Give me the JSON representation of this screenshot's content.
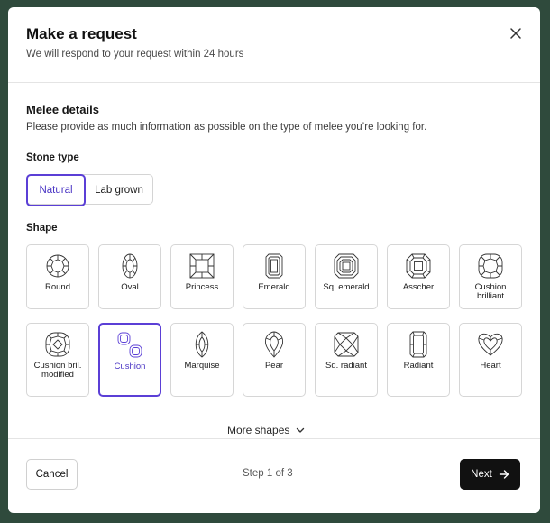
{
  "header": {
    "title": "Make a request",
    "subtitle": "We will respond to your request within 24 hours",
    "close_icon": "close-icon"
  },
  "section": {
    "title": "Melee details",
    "description": "Please provide as much information as possible on the type of melee you’re looking for."
  },
  "stone_type": {
    "label": "Stone type",
    "options": [
      "Natural",
      "Lab grown"
    ],
    "selected": "Natural"
  },
  "shape": {
    "label": "Shape",
    "options": [
      {
        "name": "Round",
        "icon": "round-diamond-icon"
      },
      {
        "name": "Oval",
        "icon": "oval-diamond-icon"
      },
      {
        "name": "Princess",
        "icon": "princess-diamond-icon"
      },
      {
        "name": "Emerald",
        "icon": "emerald-diamond-icon"
      },
      {
        "name": "Sq. emerald",
        "icon": "square-emerald-diamond-icon"
      },
      {
        "name": "Asscher",
        "icon": "asscher-diamond-icon"
      },
      {
        "name": "Cushion brilliant",
        "icon": "cushion-brilliant-diamond-icon"
      },
      {
        "name": "Cushion bril. modified",
        "icon": "cushion-modified-diamond-icon"
      },
      {
        "name": "Cushion",
        "icon": "cushion-diamond-icon"
      },
      {
        "name": "Marquise",
        "icon": "marquise-diamond-icon"
      },
      {
        "name": "Pear",
        "icon": "pear-diamond-icon"
      },
      {
        "name": "Sq. radiant",
        "icon": "square-radiant-diamond-icon"
      },
      {
        "name": "Radiant",
        "icon": "radiant-diamond-icon"
      },
      {
        "name": "Heart",
        "icon": "heart-diamond-icon"
      }
    ],
    "selected": "Cushion",
    "more_label": "More shapes"
  },
  "footer": {
    "cancel_label": "Cancel",
    "step_text": "Step 1 of 3",
    "next_label": "Next"
  },
  "colors": {
    "accent": "#5b3fd6",
    "primary_button": "#111111",
    "backdrop": "#2f4a3c"
  }
}
